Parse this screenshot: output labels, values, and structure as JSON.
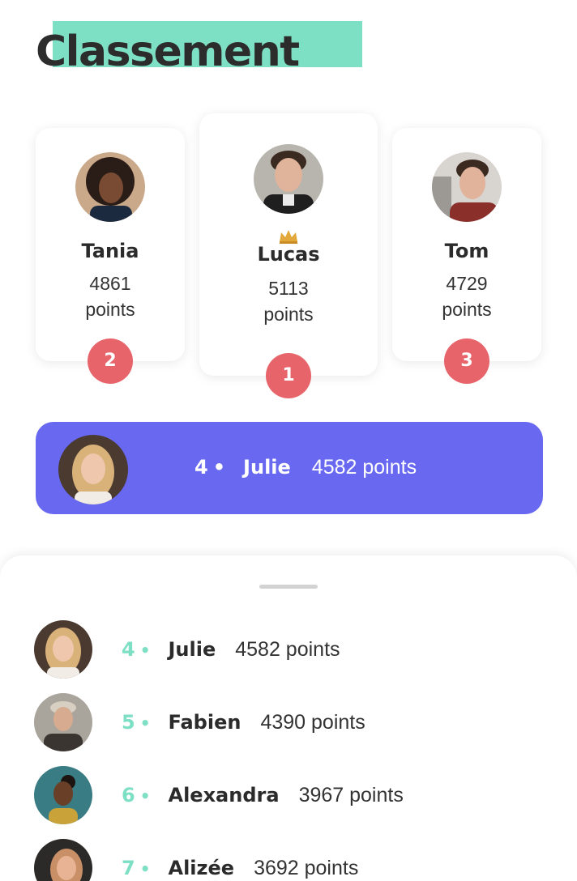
{
  "page": {
    "title": "Classement"
  },
  "podium": [
    {
      "rank": "2",
      "name": "Tania",
      "score": "4861",
      "unit": "points"
    },
    {
      "rank": "1",
      "name": "Lucas",
      "score": "5113",
      "unit": "points",
      "badge_icon": "crown-icon"
    },
    {
      "rank": "3",
      "name": "Tom",
      "score": "4729",
      "unit": "points"
    }
  ],
  "current_user": {
    "rank": "4",
    "separator": "•",
    "name": "Julie",
    "points": "4582 points"
  },
  "list": [
    {
      "rank": "4",
      "separator": "•",
      "name": "Julie",
      "points": "4582 points"
    },
    {
      "rank": "5",
      "separator": "•",
      "name": "Fabien",
      "points": "4390 points"
    },
    {
      "rank": "6",
      "separator": "•",
      "name": "Alexandra",
      "points": "3967 points"
    },
    {
      "rank": "7",
      "separator": "•",
      "name": "Alizée",
      "points": "3692 points"
    }
  ],
  "colors": {
    "accent": "#7ddfc4",
    "highlight_bar": "#6868f0",
    "rank_badge": "#e8646b"
  }
}
